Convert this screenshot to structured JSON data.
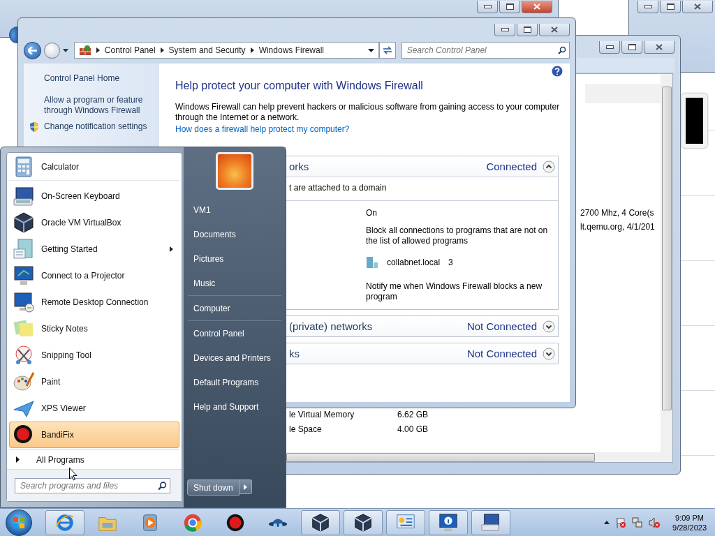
{
  "system_window": {
    "lines": [
      "2700 Mhz, 4 Core(s",
      "lt.qemu.org, 4/1/201"
    ],
    "rows": [
      {
        "label": "le Virtual Memory",
        "value": "6.62 GB"
      },
      {
        "label": "le Space",
        "value": "4.00 GB"
      }
    ]
  },
  "firewall_window": {
    "breadcrumb": [
      "Control Panel",
      "System and Security",
      "Windows Firewall"
    ],
    "search": {
      "placeholder": "Search Control Panel"
    },
    "nav": [
      {
        "label": "Control Panel Home",
        "shield": false
      },
      {
        "label": "Allow a program or feature through Windows Firewall",
        "shield": false
      },
      {
        "label": "Change notification settings",
        "shield": true
      }
    ],
    "heading": "Help protect your computer with Windows Firewall",
    "description": "Windows Firewall can help prevent hackers or malicious software from gaining access to your computer through the Internet or a network.",
    "links": [
      "How does a firewall help protect my computer?"
    ],
    "sections": [
      {
        "title": "orks",
        "status": "Connected",
        "expanded": true,
        "subtitle": "t are attached to a domain",
        "details": [
          {
            "kind": "text",
            "text": "On"
          },
          {
            "kind": "text",
            "text": "Block all connections to programs that are not on the list of allowed programs"
          },
          {
            "kind": "network",
            "text": "collabnet.local",
            "count": "3"
          },
          {
            "kind": "text",
            "text": "Notify me when Windows Firewall blocks a new program"
          }
        ]
      },
      {
        "title": "(private) networks",
        "status": "Not Connected",
        "expanded": false
      },
      {
        "title": "ks",
        "status": "Not Connected",
        "expanded": false
      }
    ]
  },
  "start_menu": {
    "programs": [
      {
        "label": "Calculator",
        "kind": "calculator",
        "submenu": false,
        "selected": false
      },
      {
        "label": "On-Screen Keyboard",
        "kind": "keyboard",
        "submenu": false,
        "selected": false
      },
      {
        "label": "Oracle VM VirtualBox",
        "kind": "cube",
        "submenu": false,
        "selected": false
      },
      {
        "label": "Getting Started",
        "kind": "document",
        "submenu": true,
        "selected": false
      },
      {
        "label": "Connect to a Projector",
        "kind": "monitor",
        "submenu": false,
        "selected": false
      },
      {
        "label": "Remote Desktop Connection",
        "kind": "remote",
        "submenu": false,
        "selected": false
      },
      {
        "label": "Sticky Notes",
        "kind": "notes",
        "submenu": false,
        "selected": false
      },
      {
        "label": "Snipping Tool",
        "kind": "scissors",
        "submenu": false,
        "selected": false
      },
      {
        "label": "Paint",
        "kind": "palette",
        "submenu": false,
        "selected": false
      },
      {
        "label": "XPS Viewer",
        "kind": "plane",
        "submenu": false,
        "selected": false
      },
      {
        "label": "BandiFix",
        "kind": "record",
        "submenu": false,
        "selected": true
      }
    ],
    "all_programs": "All Programs",
    "search": {
      "placeholder": "Search programs and files"
    },
    "place_groups": [
      {
        "items": [
          "VM1",
          "Documents",
          "Pictures",
          "Music"
        ]
      },
      {
        "items": [
          "Computer"
        ]
      },
      {
        "items": [
          "Control Panel",
          "Devices and Printers",
          "Default Programs",
          "Help and Support"
        ]
      }
    ],
    "shutdown": "Shut down"
  },
  "taskbar": {
    "apps": [
      {
        "kind": "browser",
        "running": true
      },
      {
        "kind": "folder",
        "running": false
      },
      {
        "kind": "media",
        "running": false
      },
      {
        "kind": "chrome",
        "running": false
      },
      {
        "kind": "record",
        "running": false
      },
      {
        "kind": "hat",
        "running": false
      },
      {
        "kind": "cube",
        "running": true
      },
      {
        "kind": "cube",
        "running": true
      },
      {
        "kind": "panel",
        "running": true
      },
      {
        "kind": "info",
        "running": true
      },
      {
        "kind": "keyboard",
        "running": true
      }
    ],
    "time": "9:09 PM",
    "date": "9/28/2023"
  }
}
